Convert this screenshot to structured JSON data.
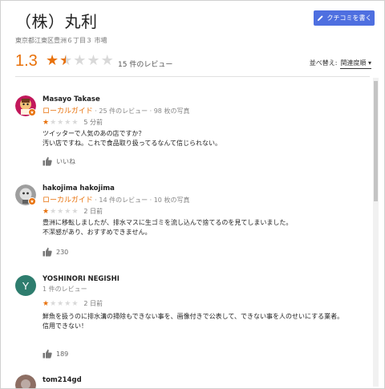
{
  "place": {
    "title": "（株）丸利",
    "address": "東京都江東区豊洲６丁目３ 市場",
    "write_review_label": "クチコミを書く"
  },
  "summary": {
    "rating": "1.3",
    "rating_value": 1.3,
    "count_label": "15 件のレビュー",
    "sort_label": "並べ替え:",
    "sort_value": "関連度順"
  },
  "reviews": [
    {
      "name": "Masayo Takase",
      "guide": "ローカルガイド",
      "stats": "· 25 件のレビュー · 98 枚の写真",
      "stars": 1,
      "when": "5 分前",
      "text": "ツイッターで人気のあの店ですか？\n汚い店ですね。これで食品取り扱ってるなんて信じられない。",
      "likes": "いいね"
    },
    {
      "name": "hakojima hakojima",
      "guide": "ローカルガイド",
      "stats": "· 14 件のレビュー · 10 枚の写真",
      "stars": 1,
      "when": "2 日前",
      "text": "豊洲に移転しましたが、排水マスに生ゴミを流し込んで捨てるのを見てしまいました。\n不潔感があり、おすすめできません。",
      "likes": "230"
    },
    {
      "name": "YOSHINORI NEGISHI",
      "initial": "Y",
      "stats": "1 件のレビュー",
      "stars": 1,
      "when": "2 日前",
      "text": "鮮魚を扱うのに排水溝の掃除もできない事を、画像付きで公表して、できない事を人のせいにする業者。\n信用できない！",
      "likes": "189"
    },
    {
      "name": "tom214gd"
    }
  ],
  "colors": {
    "accent": "#e8710a",
    "button": "#4e6fe0",
    "avatar_y": "#2e7d6e"
  }
}
